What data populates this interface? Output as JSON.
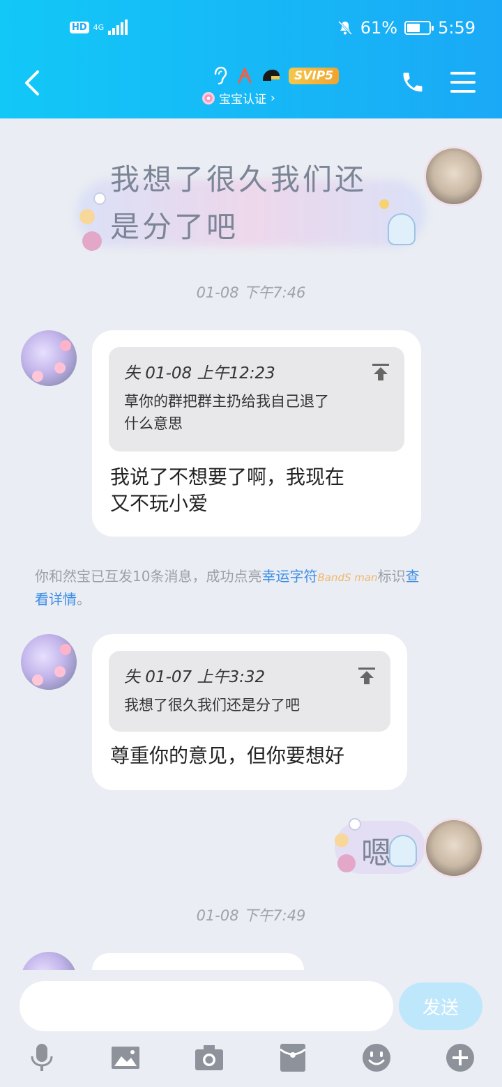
{
  "status_bar": {
    "hd": "HD",
    "network": "4G",
    "battery_percent": "61%",
    "battery_level": 0.61,
    "time": "5:59"
  },
  "header": {
    "svip_badge": "SVIP5",
    "subtitle": "宝宝认证",
    "subtitle_chevron": "›"
  },
  "messages": [
    {
      "type": "sticker_text",
      "text_line1": "我想了很久我们还",
      "text_line2": "是分了吧"
    },
    {
      "type": "timestamp",
      "text": "01-08 下午7:46"
    },
    {
      "type": "reply",
      "quote_header": "失 01-08 上午12:23",
      "quote_line1": "草你的群把群主扔给我自己退了",
      "quote_line2": "什么意思",
      "text_line1": "我说了不想要了啊，我现在",
      "text_line2": "又不玩小爱"
    },
    {
      "type": "system",
      "text_before": "你和然宝已互发10条消息，成功点亮",
      "link1": "幸运字符",
      "badge": "BandS man",
      "text_mid": "标识",
      "link2_part1": "查",
      "link2_part2": "看详情",
      "text_after": "。"
    },
    {
      "type": "reply",
      "quote_header": "失 01-07 上午3:32",
      "quote_line1": "我想了很久我们还是分了吧",
      "text_line1": "尊重你的意见，但你要想好"
    },
    {
      "type": "sticker_text",
      "text": "嗯"
    },
    {
      "type": "timestamp",
      "text": "01-08 下午7:49"
    }
  ],
  "input": {
    "value": "",
    "send_label": "发送"
  },
  "toolbar": [
    "mic-icon",
    "image-icon",
    "camera-icon",
    "red-packet-icon",
    "emoji-icon",
    "plus-icon"
  ],
  "colors": {
    "header_start": "#12c8f7",
    "header_end": "#1aa9f6",
    "background": "#eaedf3",
    "link": "#3b8ee6",
    "send_button": "#bfe7fb"
  }
}
